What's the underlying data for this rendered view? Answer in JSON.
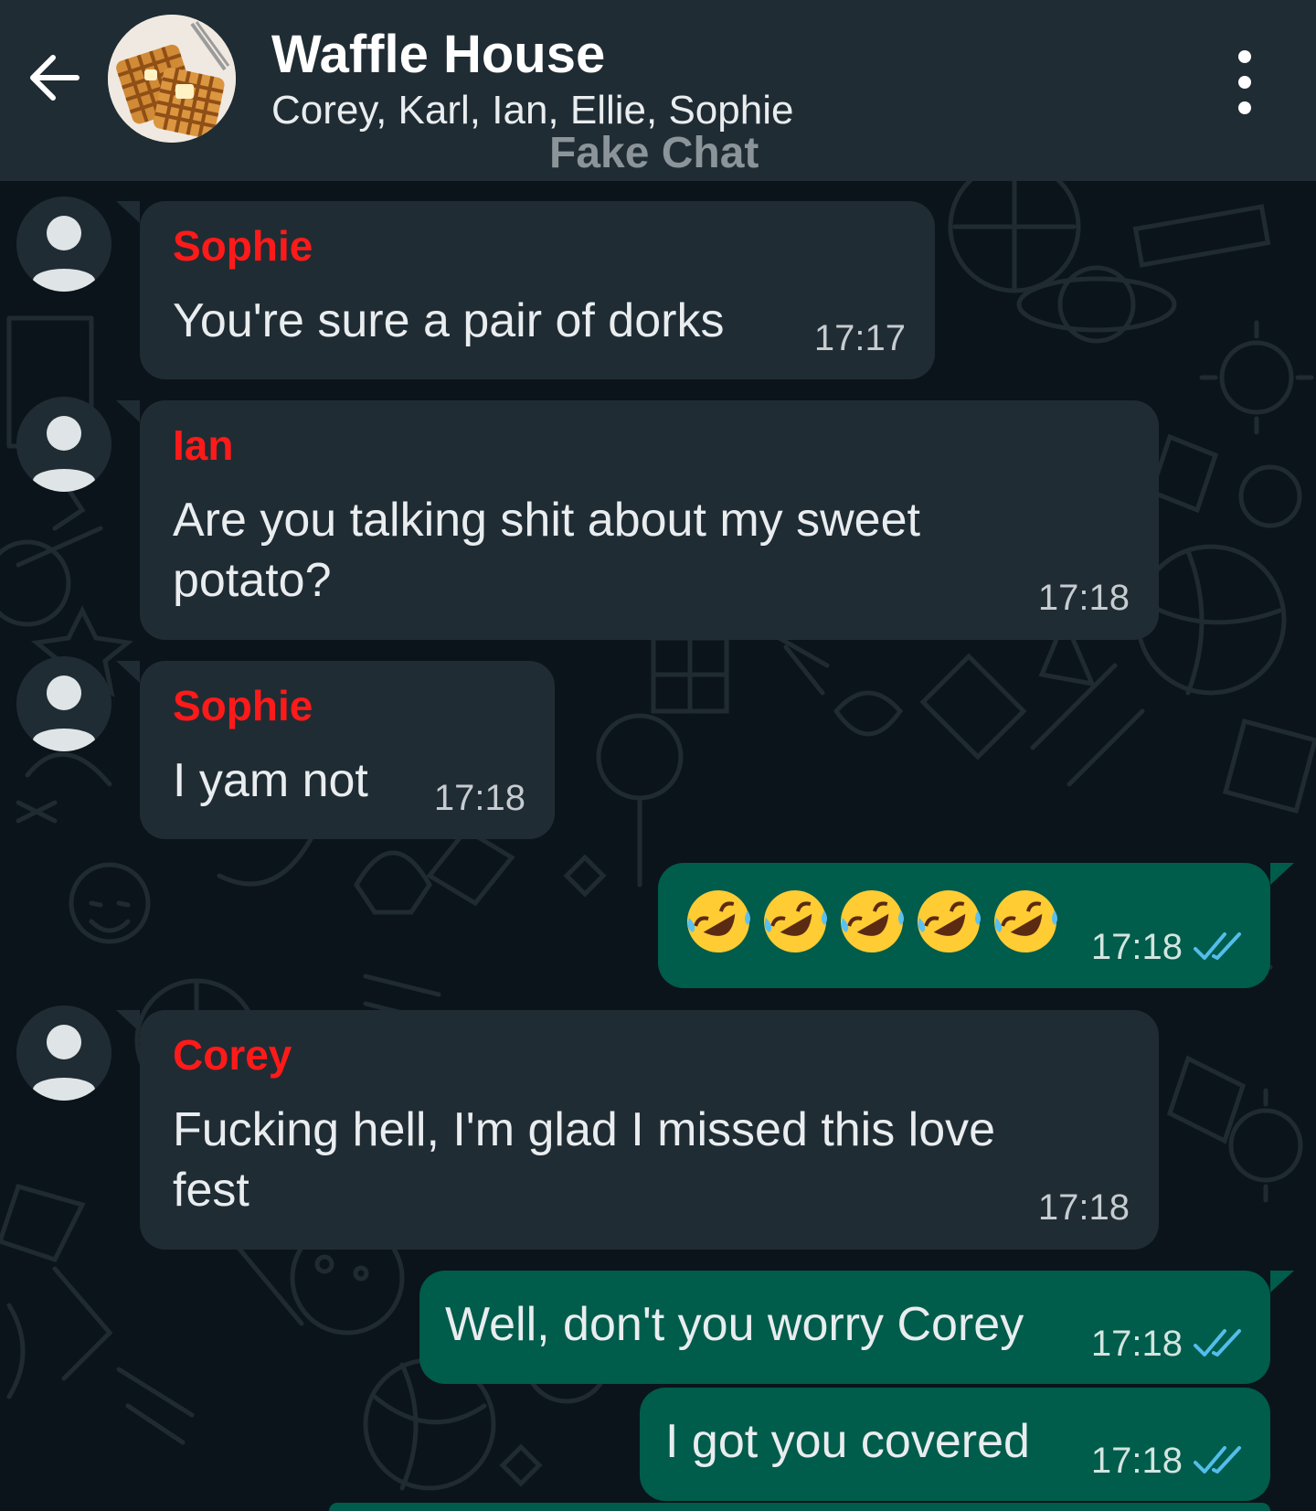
{
  "header": {
    "title": "Waffle House",
    "members": "Corey, Karl, Ian, Ellie, Sophie",
    "watermark": "Fake Chat"
  },
  "colors": {
    "header_bg": "#202c33",
    "chat_bg": "#0b141a",
    "incoming_bubble": "#202c33",
    "outgoing_bubble": "#005c4b",
    "sender_name": "#ff1a1a",
    "read_check": "#53bdeb"
  },
  "messages": [
    {
      "sender": "Sophie",
      "text": "You're sure a pair of dorks",
      "time": "17:17",
      "direction": "incoming"
    },
    {
      "sender": "Ian",
      "text": "Are you talking shit about my sweet potato?",
      "time": "17:18",
      "direction": "incoming"
    },
    {
      "sender": "Sophie",
      "text": "I yam not",
      "time": "17:18",
      "direction": "incoming"
    },
    {
      "emoji": "rolling-on-floor-laughing",
      "emoji_count": 5,
      "time": "17:18",
      "direction": "outgoing",
      "status": "read"
    },
    {
      "sender": "Corey",
      "text": "Fucking hell, I'm glad I missed this love fest",
      "time": "17:18",
      "direction": "incoming"
    },
    {
      "text": "Well, don't you worry Corey",
      "time": "17:18",
      "direction": "outgoing",
      "status": "read"
    },
    {
      "text": "I got you covered",
      "time": "17:18",
      "direction": "outgoing",
      "status": "read"
    }
  ],
  "icons": {
    "back": "arrow-left-icon",
    "menu": "more-vertical-icon",
    "group_avatar": "waffle-icon",
    "contact_avatar": "default-person-icon",
    "read_receipt": "double-check-icon",
    "emoji": "rolling-on-floor-laughing-emoji"
  }
}
